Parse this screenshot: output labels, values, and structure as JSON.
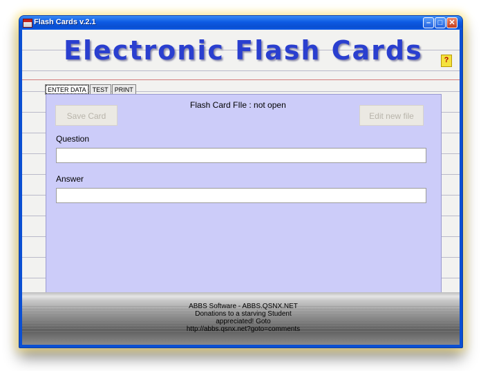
{
  "window": {
    "title": "Flash Cards v.2.1",
    "buttons": {
      "minimize": "–",
      "maximize": "□",
      "close": "✕"
    }
  },
  "banner": {
    "title": "Electronic Flash Cards",
    "help_label": "?"
  },
  "tabs": [
    {
      "label": "ENTER DATA",
      "active": true
    },
    {
      "label": "TEST",
      "active": false
    },
    {
      "label": "PRINT",
      "active": false
    }
  ],
  "form": {
    "save_button": "Save Card",
    "status": "Flash Card FIle : not open",
    "edit_button": "Edit new file",
    "question_label": "Question",
    "question_value": "",
    "answer_label": "Answer",
    "answer_value": ""
  },
  "credits": {
    "line1": "ABBS Software - ABBS.QSNX.NET",
    "line2": "Donations to a starving Student",
    "line3": "appreciated! Goto",
    "line4": "http://abbs.qsnx.net?goto=comments"
  },
  "colors": {
    "titlebar": "#0d5ae3",
    "banner_text": "#2a3fcf",
    "panel": "#ccccf9"
  }
}
